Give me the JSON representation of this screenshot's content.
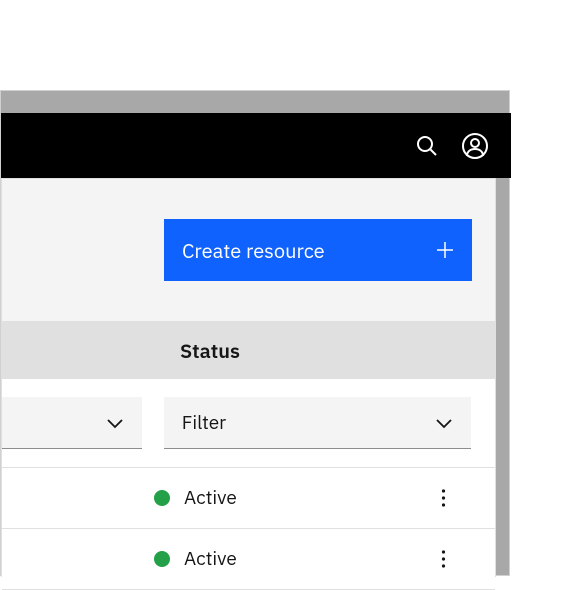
{
  "actions": {
    "create_resource": "Create resource"
  },
  "table": {
    "columns": {
      "status": "Status"
    },
    "filter_label": "Filter",
    "rows": [
      {
        "status": "Active",
        "status_color": "#24a148"
      },
      {
        "status": "Active",
        "status_color": "#24a148"
      }
    ]
  }
}
